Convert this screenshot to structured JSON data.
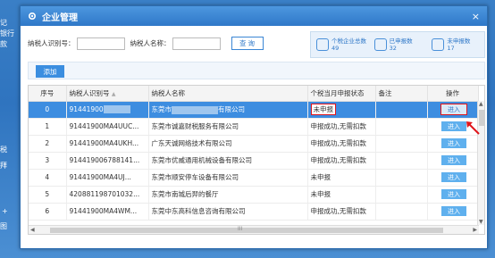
{
  "desktop": {
    "left_labels": [
      "记",
      "银行",
      "款",
      "税",
      "拜",
      "+",
      "图"
    ]
  },
  "window": {
    "title": "企业管理",
    "close_glyph": "×"
  },
  "filters": {
    "taxpayer_id_label": "纳税人识别号：",
    "taxpayer_name_label": "纳税人名称：",
    "query_button": "查 询"
  },
  "stats": [
    {
      "label": "个税企业总数",
      "value": "49",
      "icon": "users-icon"
    },
    {
      "label": "已申报数",
      "value": "32",
      "icon": "doc-check-icon"
    },
    {
      "label": "未申报数",
      "value": "17",
      "icon": "doc-pending-icon"
    }
  ],
  "toolbar": {
    "add_button": "添加"
  },
  "table": {
    "headers": [
      "序号",
      "纳税人识别号",
      "纳税人名称",
      "个税当月申报状态",
      "备注",
      "操作"
    ],
    "sort_glyph": "▲",
    "rows": [
      {
        "no": "0",
        "id": "91441900",
        "id_tail": "",
        "name_pre": "东莞市",
        "name_post": "有限公司",
        "status": "未申报",
        "note": "",
        "action": "进入",
        "selected": true
      },
      {
        "no": "1",
        "id": "91441900MA4UUC...",
        "name": "东莞市诚嘉财税服务有限公司",
        "status": "申报成功,无需扣款",
        "note": "",
        "action": "进入"
      },
      {
        "no": "2",
        "id": "91441900MA4UKH...",
        "name": "广东天诚网络技术有限公司",
        "status": "申报成功,无需扣款",
        "note": "",
        "action": "进入"
      },
      {
        "no": "3",
        "id": "914419006788141...",
        "name": "东莞市优威通用机械设备有限公司",
        "status": "申报成功,无需扣款",
        "note": "",
        "action": "进入"
      },
      {
        "no": "4",
        "id": "91441900MA4UJ...",
        "name": "东莞市顺安停车设备有限公司",
        "status": "未申报",
        "note": "",
        "action": "进入"
      },
      {
        "no": "5",
        "id": "420881198701032...",
        "name": "东莞市南城后羿的餐厅",
        "status": "未申报",
        "note": "",
        "action": "进入"
      },
      {
        "no": "6",
        "id": "91441900MA4WM...",
        "name": "东莞中东高科信息咨询有限公司",
        "status": "申报成功,无需扣款",
        "note": "",
        "action": "进入"
      }
    ]
  },
  "scroll": {
    "hbar_glyph": "III"
  },
  "colors": {
    "accent": "#3d8de0",
    "highlight": "#e0151b",
    "titlebar": "#2f78c8"
  }
}
